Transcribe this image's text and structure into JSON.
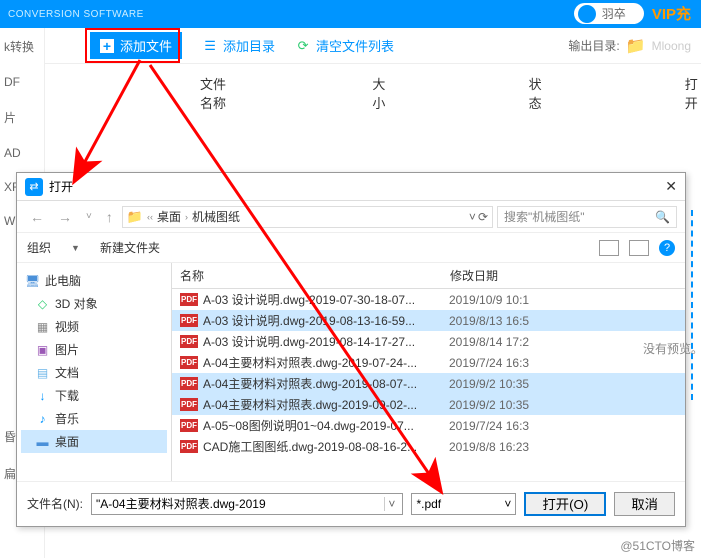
{
  "header": {
    "conversion": "CONVERSION SOFTWARE",
    "user": "羽卒",
    "vip": "VIP充"
  },
  "toolbar": {
    "add_file": "添加文件",
    "add_dir": "添加目录",
    "clear_list": "清空文件列表",
    "out_dir_label": "输出目录:",
    "out_path": "Mloong"
  },
  "cols": {
    "name": "文件名称",
    "size": "大小",
    "status": "状态",
    "open": "打开"
  },
  "sidebar": [
    "k转换",
    "DF",
    "片",
    "AD",
    "XF",
    "W",
    "昏图",
    "扁辑"
  ],
  "dialog": {
    "title": "打开",
    "breadcrumb": {
      "root": "桌面",
      "folder": "机械图纸"
    },
    "search_placeholder": "搜索\"机械图纸\"",
    "organize": "组织",
    "new_folder": "新建文件夹",
    "tree": {
      "this_pc": "此电脑",
      "objects_3d": "3D 对象",
      "videos": "视频",
      "pictures": "图片",
      "documents": "文档",
      "downloads": "下载",
      "music": "音乐",
      "desktop": "桌面"
    },
    "file_head": {
      "name": "名称",
      "date": "修改日期"
    },
    "files": [
      {
        "name": "A-03 设计说明.dwg-2019-07-30-18-07...",
        "date": "2019/10/9 10:1",
        "sel": false
      },
      {
        "name": "A-03 设计说明.dwg-2019-08-13-16-59...",
        "date": "2019/8/13 16:5",
        "sel": true
      },
      {
        "name": "A-03 设计说明.dwg-2019-08-14-17-27...",
        "date": "2019/8/14 17:2",
        "sel": false
      },
      {
        "name": "A-04主要材料对照表.dwg-2019-07-24-...",
        "date": "2019/7/24 16:3",
        "sel": false
      },
      {
        "name": "A-04主要材料对照表.dwg-2019-08-07-...",
        "date": "2019/9/2 10:35",
        "sel": true
      },
      {
        "name": "A-04主要材料对照表.dwg-2019-09-02-...",
        "date": "2019/9/2 10:35",
        "sel": true
      },
      {
        "name": "A-05~08图例说明01~04.dwg-2019-07...",
        "date": "2019/7/24 16:3",
        "sel": false
      },
      {
        "name": "CAD施工图图纸.dwg-2019-08-08-16-2...",
        "date": "2019/8/8 16:23",
        "sel": false
      }
    ],
    "no_preview": "没有预览。",
    "filename_label": "文件名(N):",
    "filename_value": "\"A-04主要材料对照表.dwg-2019",
    "filter": "*.pdf",
    "open_btn": "打开(O)",
    "cancel_btn": "取消"
  },
  "watermark": "@51CTO博客"
}
